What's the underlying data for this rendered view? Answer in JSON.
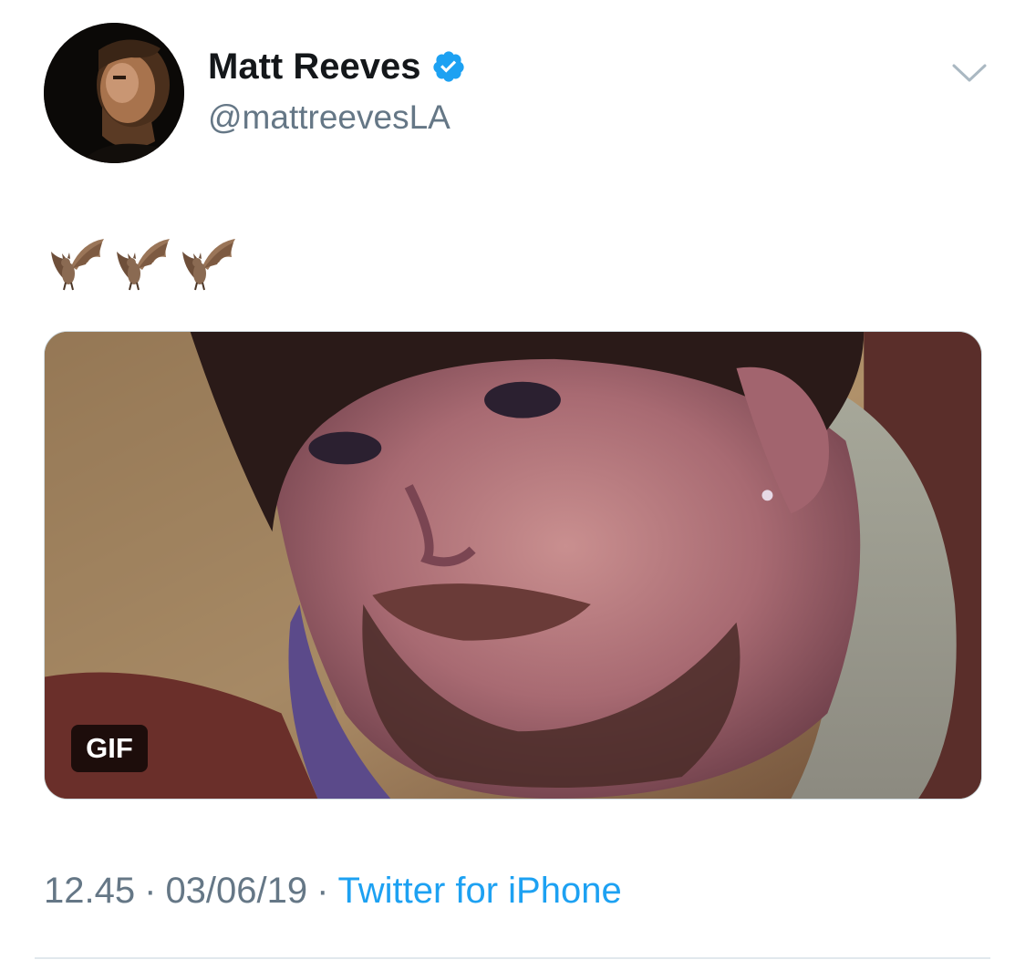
{
  "author": {
    "display_name": "Matt Reeves",
    "handle": "@mattreevesLA",
    "verified": true
  },
  "tweet": {
    "text": "🦇🦇🦇",
    "emoji_icons": [
      "bat-emoji",
      "bat-emoji",
      "bat-emoji"
    ]
  },
  "media": {
    "badge": "GIF"
  },
  "meta": {
    "time": "12.45",
    "separator": "·",
    "date": "03/06/19",
    "source": "Twitter for iPhone"
  },
  "icons": {
    "verified": "verified-badge-icon",
    "menu": "chevron-down-icon"
  },
  "colors": {
    "name": "#14171a",
    "secondary": "#657786",
    "link": "#1da1f2",
    "verified": "#1da1f2",
    "divider": "#e1e8ed"
  }
}
